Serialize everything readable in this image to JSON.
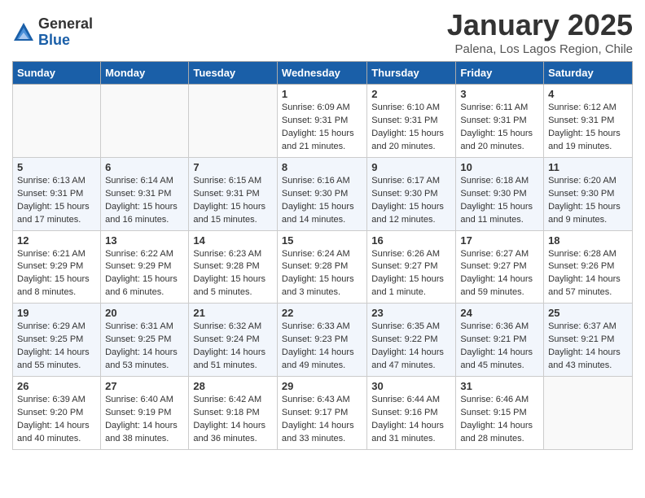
{
  "logo": {
    "general": "General",
    "blue": "Blue"
  },
  "title": "January 2025",
  "subtitle": "Palena, Los Lagos Region, Chile",
  "days_of_week": [
    "Sunday",
    "Monday",
    "Tuesday",
    "Wednesday",
    "Thursday",
    "Friday",
    "Saturday"
  ],
  "weeks": [
    [
      {
        "num": "",
        "info": ""
      },
      {
        "num": "",
        "info": ""
      },
      {
        "num": "",
        "info": ""
      },
      {
        "num": "1",
        "info": "Sunrise: 6:09 AM\nSunset: 9:31 PM\nDaylight: 15 hours and 21 minutes."
      },
      {
        "num": "2",
        "info": "Sunrise: 6:10 AM\nSunset: 9:31 PM\nDaylight: 15 hours and 20 minutes."
      },
      {
        "num": "3",
        "info": "Sunrise: 6:11 AM\nSunset: 9:31 PM\nDaylight: 15 hours and 20 minutes."
      },
      {
        "num": "4",
        "info": "Sunrise: 6:12 AM\nSunset: 9:31 PM\nDaylight: 15 hours and 19 minutes."
      }
    ],
    [
      {
        "num": "5",
        "info": "Sunrise: 6:13 AM\nSunset: 9:31 PM\nDaylight: 15 hours and 17 minutes."
      },
      {
        "num": "6",
        "info": "Sunrise: 6:14 AM\nSunset: 9:31 PM\nDaylight: 15 hours and 16 minutes."
      },
      {
        "num": "7",
        "info": "Sunrise: 6:15 AM\nSunset: 9:31 PM\nDaylight: 15 hours and 15 minutes."
      },
      {
        "num": "8",
        "info": "Sunrise: 6:16 AM\nSunset: 9:30 PM\nDaylight: 15 hours and 14 minutes."
      },
      {
        "num": "9",
        "info": "Sunrise: 6:17 AM\nSunset: 9:30 PM\nDaylight: 15 hours and 12 minutes."
      },
      {
        "num": "10",
        "info": "Sunrise: 6:18 AM\nSunset: 9:30 PM\nDaylight: 15 hours and 11 minutes."
      },
      {
        "num": "11",
        "info": "Sunrise: 6:20 AM\nSunset: 9:30 PM\nDaylight: 15 hours and 9 minutes."
      }
    ],
    [
      {
        "num": "12",
        "info": "Sunrise: 6:21 AM\nSunset: 9:29 PM\nDaylight: 15 hours and 8 minutes."
      },
      {
        "num": "13",
        "info": "Sunrise: 6:22 AM\nSunset: 9:29 PM\nDaylight: 15 hours and 6 minutes."
      },
      {
        "num": "14",
        "info": "Sunrise: 6:23 AM\nSunset: 9:28 PM\nDaylight: 15 hours and 5 minutes."
      },
      {
        "num": "15",
        "info": "Sunrise: 6:24 AM\nSunset: 9:28 PM\nDaylight: 15 hours and 3 minutes."
      },
      {
        "num": "16",
        "info": "Sunrise: 6:26 AM\nSunset: 9:27 PM\nDaylight: 15 hours and 1 minute."
      },
      {
        "num": "17",
        "info": "Sunrise: 6:27 AM\nSunset: 9:27 PM\nDaylight: 14 hours and 59 minutes."
      },
      {
        "num": "18",
        "info": "Sunrise: 6:28 AM\nSunset: 9:26 PM\nDaylight: 14 hours and 57 minutes."
      }
    ],
    [
      {
        "num": "19",
        "info": "Sunrise: 6:29 AM\nSunset: 9:25 PM\nDaylight: 14 hours and 55 minutes."
      },
      {
        "num": "20",
        "info": "Sunrise: 6:31 AM\nSunset: 9:25 PM\nDaylight: 14 hours and 53 minutes."
      },
      {
        "num": "21",
        "info": "Sunrise: 6:32 AM\nSunset: 9:24 PM\nDaylight: 14 hours and 51 minutes."
      },
      {
        "num": "22",
        "info": "Sunrise: 6:33 AM\nSunset: 9:23 PM\nDaylight: 14 hours and 49 minutes."
      },
      {
        "num": "23",
        "info": "Sunrise: 6:35 AM\nSunset: 9:22 PM\nDaylight: 14 hours and 47 minutes."
      },
      {
        "num": "24",
        "info": "Sunrise: 6:36 AM\nSunset: 9:21 PM\nDaylight: 14 hours and 45 minutes."
      },
      {
        "num": "25",
        "info": "Sunrise: 6:37 AM\nSunset: 9:21 PM\nDaylight: 14 hours and 43 minutes."
      }
    ],
    [
      {
        "num": "26",
        "info": "Sunrise: 6:39 AM\nSunset: 9:20 PM\nDaylight: 14 hours and 40 minutes."
      },
      {
        "num": "27",
        "info": "Sunrise: 6:40 AM\nSunset: 9:19 PM\nDaylight: 14 hours and 38 minutes."
      },
      {
        "num": "28",
        "info": "Sunrise: 6:42 AM\nSunset: 9:18 PM\nDaylight: 14 hours and 36 minutes."
      },
      {
        "num": "29",
        "info": "Sunrise: 6:43 AM\nSunset: 9:17 PM\nDaylight: 14 hours and 33 minutes."
      },
      {
        "num": "30",
        "info": "Sunrise: 6:44 AM\nSunset: 9:16 PM\nDaylight: 14 hours and 31 minutes."
      },
      {
        "num": "31",
        "info": "Sunrise: 6:46 AM\nSunset: 9:15 PM\nDaylight: 14 hours and 28 minutes."
      },
      {
        "num": "",
        "info": ""
      }
    ]
  ]
}
